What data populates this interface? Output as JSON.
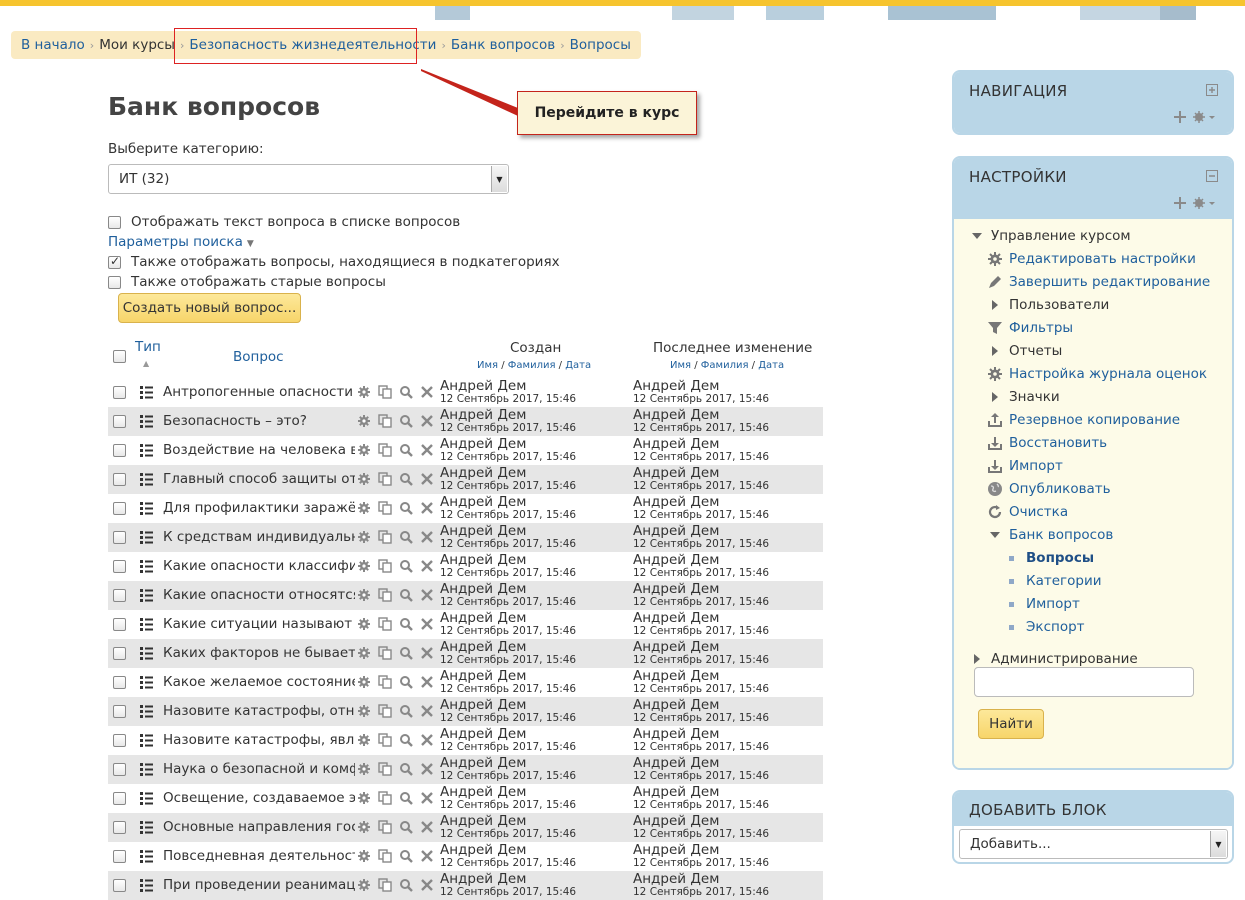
{
  "breadcrumb": [
    {
      "label": "В начало",
      "link": true
    },
    {
      "label": "Мои курсы",
      "link": false
    },
    {
      "label": "Безопасность жизнедеятельности",
      "link": true
    },
    {
      "label": "Банк вопросов",
      "link": true
    },
    {
      "label": "Вопросы",
      "link": true
    }
  ],
  "callout": {
    "text": "Перейдите в курс",
    "border_color": "#c4241b"
  },
  "page": {
    "title": "Банк вопросов",
    "category_label": "Выберите категорию:",
    "category_value": "ИТ (32)",
    "opt_show_text": "Отображать текст вопроса в списке вопросов",
    "search_params": "Параметры поиска",
    "opt_subcats": "Также отображать вопросы, находящиеся в подкатегориях",
    "opt_old": "Также отображать старые вопросы",
    "create_button": "Создать новый вопрос..."
  },
  "table": {
    "col_type": "Тип",
    "col_question": "Вопрос",
    "col_created": "Создан",
    "col_modified": "Последнее изменение",
    "sub_first": "Имя",
    "sub_last": "Фамилия",
    "sub_date": "Дата",
    "sub_sep": "/",
    "rows": [
      {
        "name": "Антропогенные опасности",
        "author": "Андрей Дем",
        "date": "12 Сентябрь 2017, 15:46"
      },
      {
        "name": "Безопасность – это?",
        "author": "Андрей Дем",
        "date": "12 Сентябрь 2017, 15:46"
      },
      {
        "name": "Воздействие на человека вре",
        "author": "Андрей Дем",
        "date": "12 Сентябрь 2017, 15:46"
      },
      {
        "name": "Главный способ защиты от по",
        "author": "Андрей Дем",
        "date": "12 Сентябрь 2017, 15:46"
      },
      {
        "name": "Для профилактики заражённ",
        "author": "Андрей Дем",
        "date": "12 Сентябрь 2017, 15:46"
      },
      {
        "name": "К средствам индивидуальной",
        "author": "Андрей Дем",
        "date": "12 Сентябрь 2017, 15:46"
      },
      {
        "name": "Какие опасности классифицир",
        "author": "Андрей Дем",
        "date": "12 Сентябрь 2017, 15:46"
      },
      {
        "name": "Какие опасности относятся к",
        "author": "Андрей Дем",
        "date": "12 Сентябрь 2017, 15:46"
      },
      {
        "name": "Какие ситуации называют экс",
        "author": "Андрей Дем",
        "date": "12 Сентябрь 2017, 15:46"
      },
      {
        "name": "Каких факторов не бывает?",
        "author": "Андрей Дем",
        "date": "12 Сентябрь 2017, 15:46"
      },
      {
        "name": "Какое желаемое состояние о",
        "author": "Андрей Дем",
        "date": "12 Сентябрь 2017, 15:46"
      },
      {
        "name": "Назовите катастрофы, относя",
        "author": "Андрей Дем",
        "date": "12 Сентябрь 2017, 15:46"
      },
      {
        "name": "Назовите катастрофы, являю",
        "author": "Андрей Дем",
        "date": "12 Сентябрь 2017, 15:46"
      },
      {
        "name": "Наука о безопасной и комфор",
        "author": "Андрей Дем",
        "date": "12 Сентябрь 2017, 15:46"
      },
      {
        "name": "Освещение, создаваемое эле",
        "author": "Андрей Дем",
        "date": "12 Сентябрь 2017, 15:46"
      },
      {
        "name": "Основные направления госуд",
        "author": "Андрей Дем",
        "date": "12 Сентябрь 2017, 15:46"
      },
      {
        "name": "Повседневная деятельность",
        "author": "Андрей Дем",
        "date": "12 Сентябрь 2017, 15:46"
      },
      {
        "name": "При проведении реанимацио",
        "author": "Андрей Дем",
        "date": "12 Сентябрь 2017, 15:46"
      }
    ]
  },
  "navigation_block": {
    "title": "НАВИГАЦИЯ"
  },
  "settings_block": {
    "title": "НАСТРОЙКИ",
    "course_admin": "Управление курсом",
    "items": {
      "edit_settings": "Редактировать настройки",
      "finish_editing": "Завершить редактирование",
      "users": "Пользователи",
      "filters": "Фильтры",
      "reports": "Отчеты",
      "gradebook_setup": "Настройка журнала оценок",
      "badges": "Значки",
      "backup": "Резервное копирование",
      "restore": "Восстановить",
      "import": "Импорт",
      "publish": "Опубликовать",
      "reset": "Очистка",
      "question_bank": "Банк вопросов",
      "qb_questions": "Вопросы",
      "qb_categories": "Категории",
      "qb_import": "Импорт",
      "qb_export": "Экспорт"
    },
    "site_admin": "Администрирование",
    "search_value": "",
    "find_button": "Найти"
  },
  "add_block": {
    "title": "ДОБАВИТЬ БЛОК",
    "select_value": "Добавить..."
  }
}
